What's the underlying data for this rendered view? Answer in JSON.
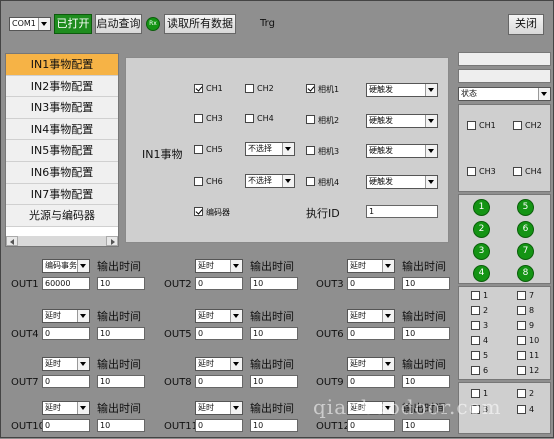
{
  "toolbar": {
    "port": "COM1",
    "open_btn": "已打开",
    "start_btn": "启动查询",
    "rx_led": "Rx",
    "read_btn": "读取所有数据",
    "trg": "Trg",
    "close_btn": "关闭"
  },
  "nav": {
    "items": [
      "IN1事物配置",
      "IN2事物配置",
      "IN3事物配置",
      "IN4事物配置",
      "IN5事物配置",
      "IN6事物配置",
      "IN7事物配置",
      "光源与编码器"
    ],
    "selected_index": 0
  },
  "config": {
    "title": "IN1事物",
    "ch1": "CH1",
    "ch2": "CH2",
    "ch3": "CH3",
    "ch4": "CH4",
    "ch5": "CH5",
    "ch6": "CH6",
    "ch5_sel": "不选择",
    "ch6_sel": "不选择",
    "cam1": "相机1",
    "cam2": "相机2",
    "cam3": "相机3",
    "cam4": "相机4",
    "cam1_sel": "硬触发",
    "cam2_sel": "硬触发",
    "cam3_sel": "硬触发",
    "cam4_sel": "硬触发",
    "encoder": "编码器",
    "exec_id_label": "执行ID",
    "exec_id": "1",
    "checked": {
      "ch1": true,
      "cam1": true,
      "encoder": true
    }
  },
  "outputs": {
    "time_label": "输出时间",
    "items": [
      {
        "name": "OUT1",
        "mode": "编码事务",
        "a": "60000",
        "b": "10"
      },
      {
        "name": "OUT2",
        "mode": "延时",
        "a": "0",
        "b": "10"
      },
      {
        "name": "OUT3",
        "mode": "延时",
        "a": "0",
        "b": "10"
      },
      {
        "name": "OUT4",
        "mode": "延时",
        "a": "0",
        "b": "10"
      },
      {
        "name": "OUT5",
        "mode": "延时",
        "a": "0",
        "b": "10"
      },
      {
        "name": "OUT6",
        "mode": "延时",
        "a": "0",
        "b": "10"
      },
      {
        "name": "OUT7",
        "mode": "延时",
        "a": "0",
        "b": "10"
      },
      {
        "name": "OUT8",
        "mode": "延时",
        "a": "0",
        "b": "10"
      },
      {
        "name": "OUT9",
        "mode": "延时",
        "a": "0",
        "b": "10"
      },
      {
        "name": "OUT10",
        "mode": "延时",
        "a": "0",
        "b": "10"
      },
      {
        "name": "OUT11",
        "mode": "延时",
        "a": "0",
        "b": "10"
      },
      {
        "name": "OUT12",
        "mode": "延时",
        "a": "0",
        "b": "10"
      }
    ]
  },
  "right": {
    "status": "状态",
    "ch1": "CH1",
    "ch2": "CH2",
    "ch3": "CH3",
    "ch4": "CH4",
    "leds": [
      "1",
      "5",
      "2",
      "6",
      "3",
      "7",
      "4",
      "8"
    ],
    "checks": [
      "1",
      "7",
      "2",
      "8",
      "3",
      "9",
      "4",
      "10",
      "5",
      "11",
      "6",
      "12"
    ],
    "checks2": [
      "1",
      "2",
      "3",
      "4"
    ]
  },
  "watermark": "qianbaodoor.com",
  "colors": {
    "selected_nav": "#f6b346",
    "led": "#149414",
    "panel": "#cfcfcf"
  }
}
